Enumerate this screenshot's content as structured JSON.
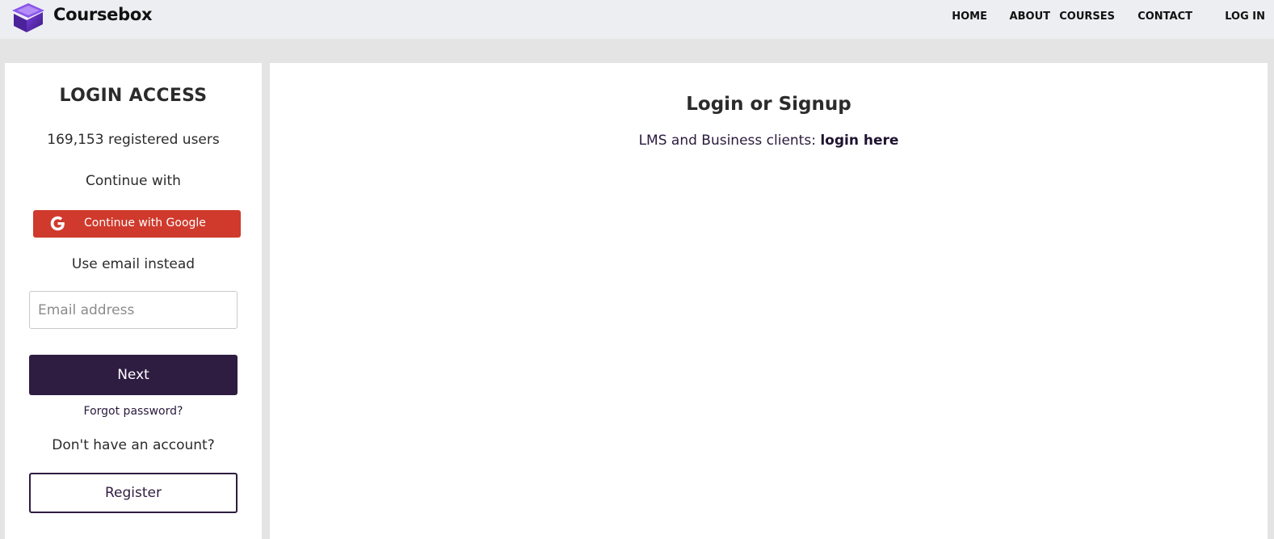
{
  "header": {
    "brand": "Coursebox",
    "nav": [
      "HOME",
      "ABOUT",
      "COURSES",
      "CONTACT",
      "LOG IN"
    ]
  },
  "login_panel": {
    "title": "LOGIN ACCESS",
    "registered_users": "169,153 registered users",
    "continue_with": "Continue with",
    "google_button": "Continue with Google",
    "use_email": "Use email instead",
    "email_placeholder": "Email address",
    "email_value": "",
    "next_button": "Next",
    "forgot_password": "Forgot password?",
    "no_account": "Don't have an account?",
    "register_button": "Register"
  },
  "main": {
    "title": "Login or Signup",
    "lms_text": "LMS and Business clients: ",
    "lms_link": "login here"
  },
  "icons": {
    "logo": "graduation-cap-cube-icon",
    "google": "google-g-icon"
  },
  "colors": {
    "brand_purple": "#2f1c41",
    "google_red": "#cf3a2c",
    "topbar_bg": "#edeef2",
    "page_bg": "#e4e4e4"
  }
}
